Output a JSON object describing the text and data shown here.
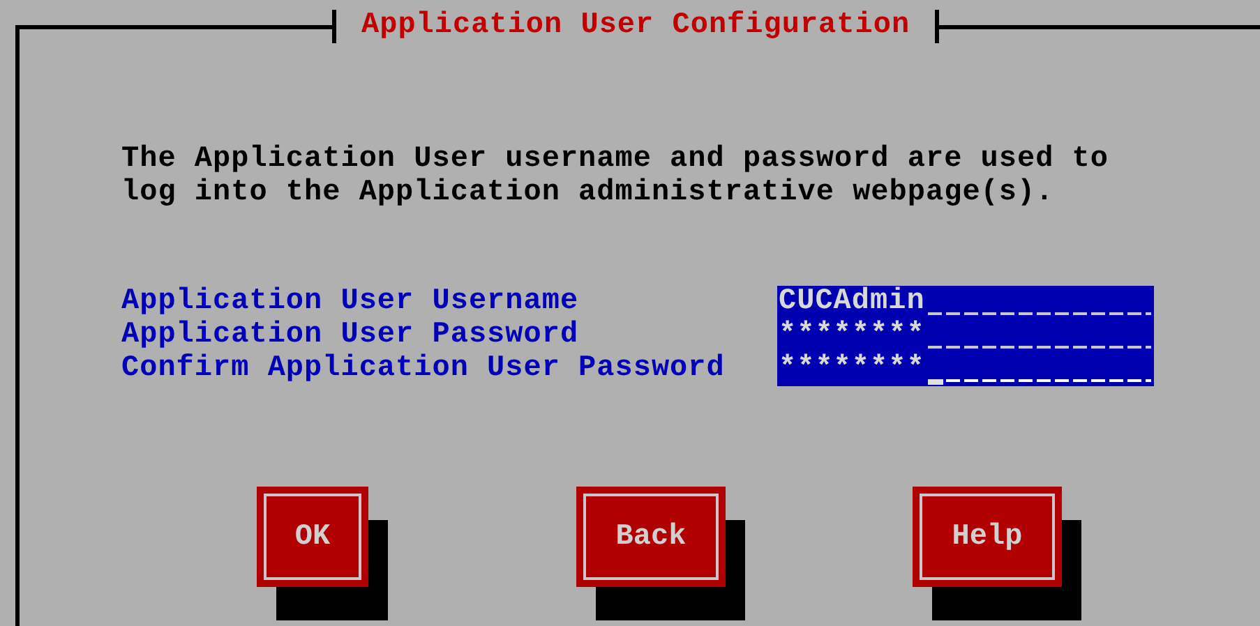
{
  "window": {
    "title": "Application User Configuration"
  },
  "intro": "The Application User username and password are used to log into the Application administrative webpage(s).",
  "fields": [
    {
      "label": "Application User Username",
      "value": "CUCAdmin",
      "focused": false
    },
    {
      "label": "Application User Password",
      "value": "********",
      "focused": false
    },
    {
      "label": "Confirm Application User Password",
      "value": "********",
      "focused": true
    }
  ],
  "buttons": [
    "OK",
    "Back",
    "Help"
  ]
}
